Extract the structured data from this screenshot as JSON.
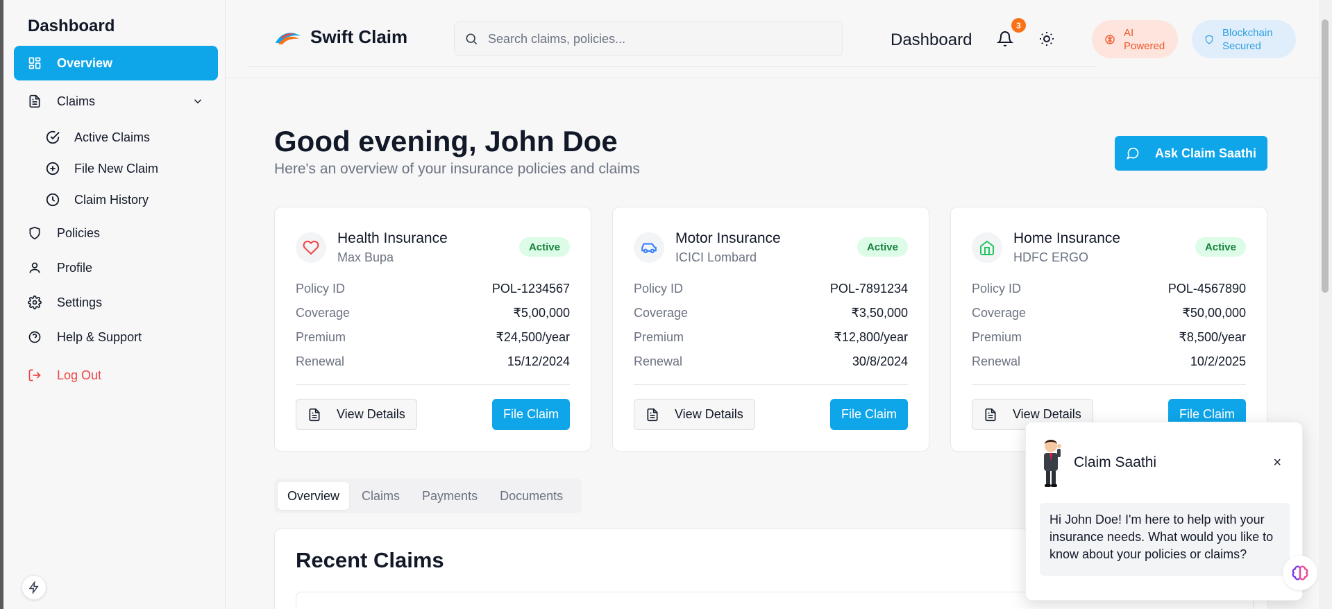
{
  "sidebar": {
    "title": "Dashboard",
    "overview": "Overview",
    "claims": "Claims",
    "claims_sub": [
      {
        "label": "Active Claims",
        "icon": "check-circle-icon"
      },
      {
        "label": "File New Claim",
        "icon": "plus-circle-icon"
      },
      {
        "label": "Claim History",
        "icon": "clock-icon"
      }
    ],
    "policies": "Policies",
    "profile": "Profile",
    "settings": "Settings",
    "help": "Help & Support",
    "logout": "Log Out"
  },
  "header": {
    "brand": "Swift Claim",
    "search_placeholder": "Search claims, policies...",
    "title": "Dashboard",
    "notification_count": "3",
    "ai_label_1": "AI",
    "ai_label_2": "Powered",
    "bc_label_1": "Blockchain",
    "bc_label_2": "Secured"
  },
  "main": {
    "greeting": "Good evening, John Doe",
    "subtitle": "Here's an overview of your insurance policies and claims",
    "ask_button": "Ask Claim Saathi",
    "row_labels": {
      "policy_id": "Policy ID",
      "coverage": "Coverage",
      "premium": "Premium",
      "renewal": "Renewal"
    },
    "view_details": "View Details",
    "file_claim": "File Claim",
    "cards": [
      {
        "title": "Health Insurance",
        "provider": "Max Bupa",
        "status": "Active",
        "policy_id": "POL-1234567",
        "coverage": "₹5,00,000",
        "premium": "₹24,500/year",
        "renewal": "15/12/2024",
        "icon": "heart-icon",
        "icon_color": "#ef4444"
      },
      {
        "title": "Motor Insurance",
        "provider": "ICICI Lombard",
        "status": "Active",
        "policy_id": "POL-7891234",
        "coverage": "₹3,50,000",
        "premium": "₹12,800/year",
        "renewal": "30/8/2024",
        "icon": "car-icon",
        "icon_color": "#3b82f6"
      },
      {
        "title": "Home Insurance",
        "provider": "HDFC ERGO",
        "status": "Active",
        "policy_id": "POL-4567890",
        "coverage": "₹50,00,000",
        "premium": "₹8,500/year",
        "renewal": "10/2/2025",
        "icon": "home-icon",
        "icon_color": "#22c55e"
      }
    ],
    "tabs": [
      "Overview",
      "Claims",
      "Payments",
      "Documents"
    ],
    "active_tab": "Overview",
    "recent_title": "Recent Claims"
  },
  "chat": {
    "name": "Claim Saathi",
    "close": "×",
    "message": "Hi John Doe! I'm here to help with your insurance needs. What would you like to know about your policies or claims?"
  },
  "colors": {
    "accent": "#0ea5e9",
    "danger": "#ef4444",
    "active_badge_bg": "#dcfce7",
    "active_badge_text": "#15803d"
  }
}
